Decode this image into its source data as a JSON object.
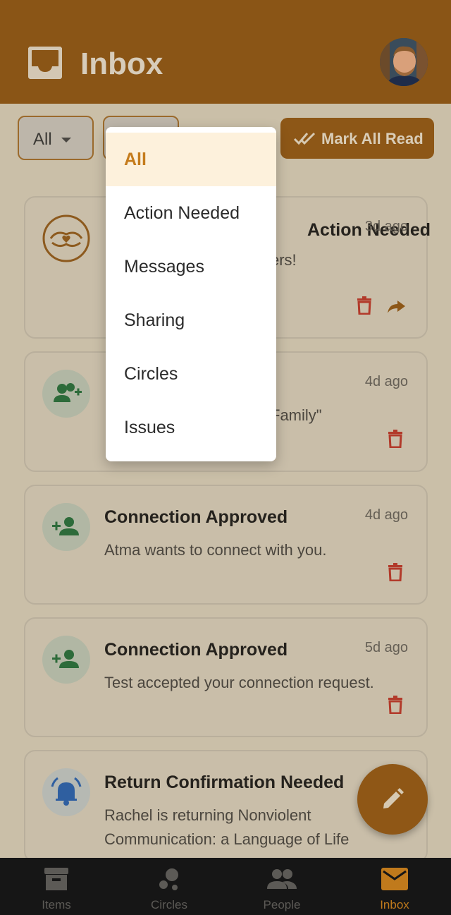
{
  "header": {
    "title": "Inbox"
  },
  "filters": {
    "type_value": "All",
    "category_value": "",
    "mark_all_label": "Mark All Read"
  },
  "dropdown": {
    "options": [
      "All",
      "Action Needed",
      "Messages",
      "Sharing",
      "Circles",
      "Issues"
    ],
    "selected": "All"
  },
  "notifications": [
    {
      "title_visible": "Action Needed",
      "time": "3d ago",
      "message_visible": "ers!",
      "icon": "handshake-heart-icon"
    },
    {
      "title_visible": "",
      "time": "4d ago",
      "message_visible": "Family\"",
      "icon": "group-add-icon"
    },
    {
      "title": "Connection Approved",
      "time": "4d ago",
      "message": "Atma wants to connect with you.",
      "icon": "person-add-icon"
    },
    {
      "title": "Connection Approved",
      "time": "5d ago",
      "message": "Test accepted your connection request.",
      "icon": "person-add-icon"
    },
    {
      "title": "Return Confirmation Needed",
      "time": "",
      "message_line1": "Rachel is returning Nonviolent",
      "message_line2": "Communication: a Language of Life",
      "icon": "bell-icon"
    }
  ],
  "bottom_nav": {
    "items": [
      {
        "label": "Items",
        "icon": "archive-box-icon"
      },
      {
        "label": "Circles",
        "icon": "circles-icon"
      },
      {
        "label": "People",
        "icon": "people-icon"
      },
      {
        "label": "Inbox",
        "icon": "mail-icon",
        "active": true
      }
    ]
  },
  "colors": {
    "header_bg": "#8a5516",
    "accent": "#c57c1c",
    "delete": "#b23a2a",
    "nav_bg": "#161616"
  }
}
